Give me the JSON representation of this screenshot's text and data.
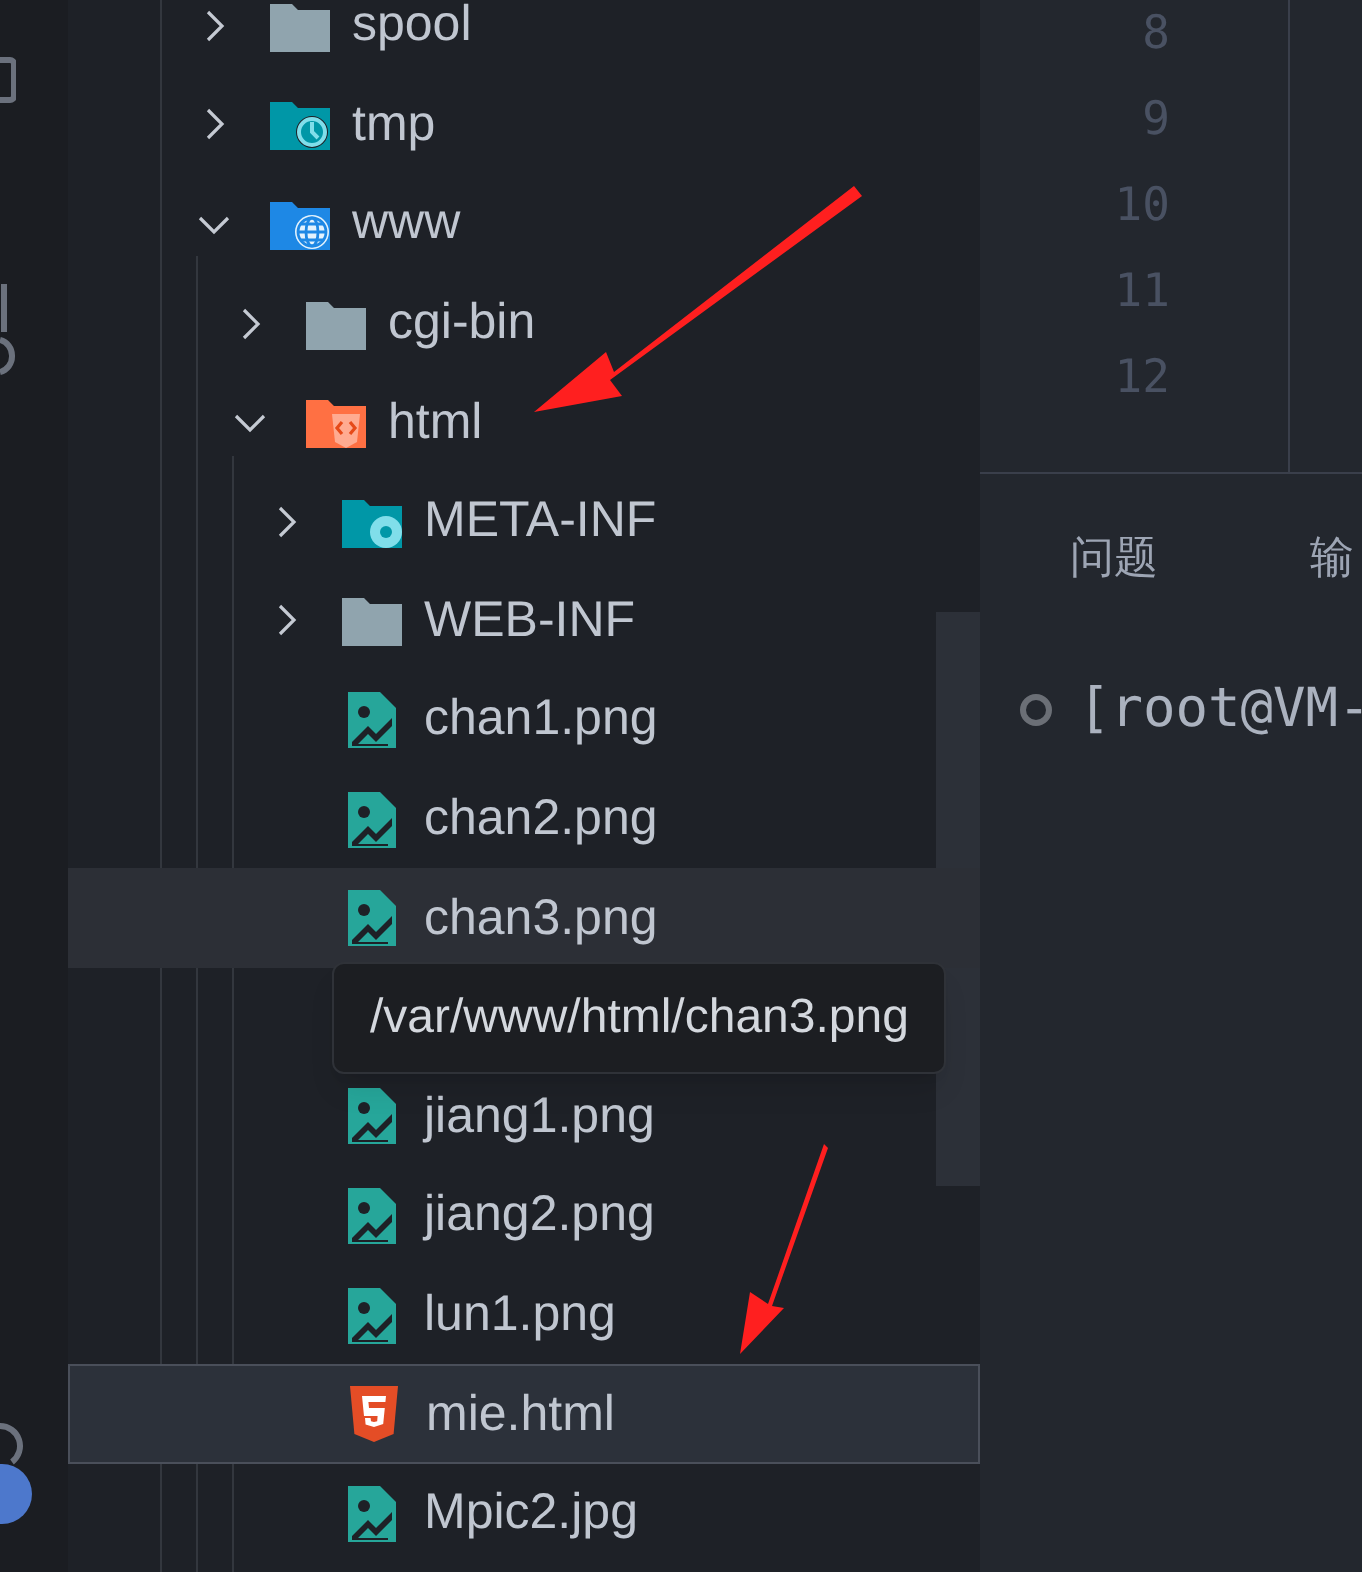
{
  "explorer": {
    "tree": [
      {
        "kind": "folder",
        "label": "spool",
        "expanded": false
      },
      {
        "kind": "folder-clock",
        "label": "tmp",
        "expanded": false
      },
      {
        "kind": "folder-globe",
        "label": "www",
        "expanded": true,
        "children": [
          {
            "kind": "folder",
            "label": "cgi-bin",
            "expanded": false
          },
          {
            "kind": "folder-code",
            "label": "html",
            "expanded": true,
            "children": [
              {
                "kind": "folder-gear",
                "label": "META-INF",
                "expanded": false
              },
              {
                "kind": "folder",
                "label": "WEB-INF",
                "expanded": false
              },
              {
                "kind": "image",
                "label": "chan1.png",
                "hovered": false,
                "selected": false
              },
              {
                "kind": "image",
                "label": "chan2.png",
                "hovered": false,
                "selected": false
              },
              {
                "kind": "image",
                "label": "chan3.png",
                "hovered": true,
                "selected": false,
                "tooltip": "/var/www/html/chan3.png"
              },
              {
                "kind": "image",
                "label": "jiang1.png",
                "hovered": false,
                "selected": false
              },
              {
                "kind": "image",
                "label": "jiang2.png",
                "hovered": false,
                "selected": false
              },
              {
                "kind": "image",
                "label": "lun1.png",
                "hovered": false,
                "selected": false
              },
              {
                "kind": "html",
                "label": "mie.html",
                "hovered": false,
                "selected": true
              },
              {
                "kind": "image",
                "label": "Mpic2.jpg",
                "hovered": false,
                "selected": false
              }
            ]
          }
        ]
      }
    ]
  },
  "editor": {
    "line_numbers": [
      "8",
      "9",
      "10",
      "11",
      "12"
    ]
  },
  "panel": {
    "tabs": [
      {
        "label": "问题"
      },
      {
        "label": "输"
      }
    ],
    "terminal": {
      "line": "[root@VM-"
    }
  }
}
